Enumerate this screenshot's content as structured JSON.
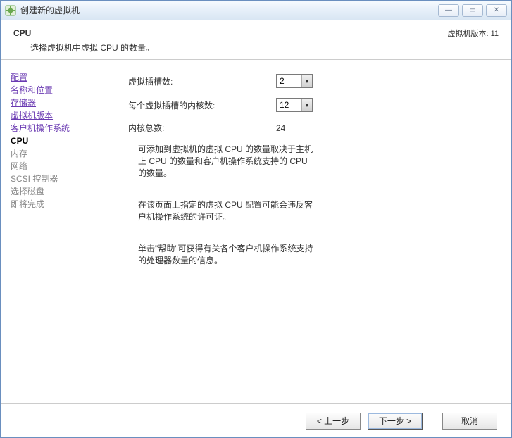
{
  "window": {
    "title": "创建新的虚拟机"
  },
  "header": {
    "title": "CPU",
    "subtitle": "选择虚拟机中虚拟 CPU 的数量。",
    "version": "虚拟机版本: 11"
  },
  "sidebar": {
    "items": [
      {
        "label": "配置",
        "state": "visited"
      },
      {
        "label": "名称和位置",
        "state": "visited"
      },
      {
        "label": "存储器",
        "state": "visited"
      },
      {
        "label": "虚拟机版本",
        "state": "visited"
      },
      {
        "label": "客户机操作系统",
        "state": "visited"
      },
      {
        "label": "CPU",
        "state": "current"
      },
      {
        "label": "内存",
        "state": "future"
      },
      {
        "label": "网络",
        "state": "future"
      },
      {
        "label": "SCSI 控制器",
        "state": "future"
      },
      {
        "label": "选择磁盘",
        "state": "future"
      },
      {
        "label": "即将完成",
        "state": "future"
      }
    ]
  },
  "form": {
    "sockets_label": "虚拟插槽数:",
    "sockets_value": "2",
    "cores_label": "每个虚拟插槽的内核数:",
    "cores_value": "12",
    "total_label": "内核总数:",
    "total_value": "24"
  },
  "info": {
    "p1": "可添加到虚拟机的虚拟 CPU 的数量取决于主机上 CPU 的数量和客户机操作系统支持的 CPU 的数量。",
    "p2": "在该页面上指定的虚拟 CPU 配置可能会违反客户机操作系统的许可证。",
    "p3": "单击\"帮助\"可获得有关各个客户机操作系统支持的处理器数量的信息。"
  },
  "footer": {
    "back": "< 上一步",
    "next": "下一步 >",
    "cancel": "取消"
  },
  "icons": {
    "minimize": "—",
    "maximize": "▭",
    "close": "✕",
    "dropdown": "▼"
  }
}
